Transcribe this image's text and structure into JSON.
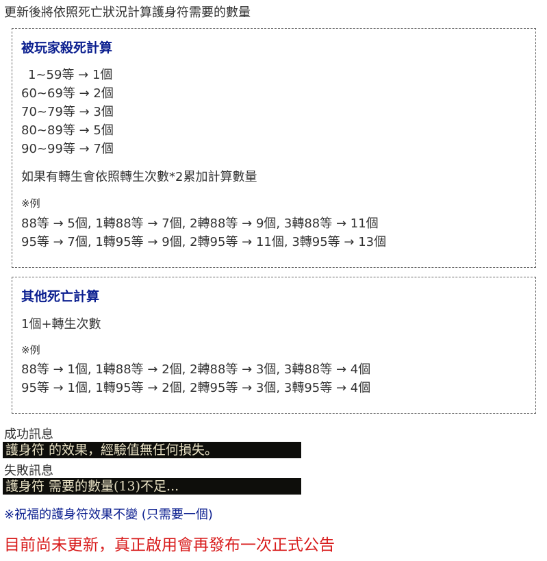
{
  "intro": "更新後將依照死亡狀況計算護身符需要的數量",
  "pk_section": {
    "title": "被玩家殺死計算",
    "levels": [
      "1~59等 → 1個",
      "60~69等 → 2個",
      "70~79等 → 3個",
      "80~89等 → 5個",
      "90~99等 → 7個"
    ],
    "rebirth_note": "如果有轉生會依照轉生次數*2累加計算數量",
    "example_label": "※例",
    "examples": [
      "88等 → 5個, 1轉88等 → 7個, 2轉88等 → 9個, 3轉88等 → 11個",
      "95等 → 7個, 1轉95等 → 9個, 2轉95等 → 11個, 3轉95等 → 13個"
    ]
  },
  "other_section": {
    "title": "其他死亡計算",
    "rule": "1個+轉生次數",
    "example_label": "※例",
    "examples": [
      "88等 → 1個, 1轉88等 → 2個, 2轉88等 → 3個, 3轉88等 → 4個",
      "95等 → 1個, 1轉95等 → 2個, 2轉95等 → 3個, 3轉95等 → 4個"
    ]
  },
  "messages": {
    "success_label": "成功訊息",
    "success_text": "護身符 的效果，經驗值無任何損失。",
    "fail_label": "失敗訊息",
    "fail_text": "護身符 需要的數量(13)不足..."
  },
  "blessed_note": "※祝福的護身符效果不變 (只需要一個)",
  "notice": "目前尚未更新，真正啟用會再發布一次正式公告"
}
